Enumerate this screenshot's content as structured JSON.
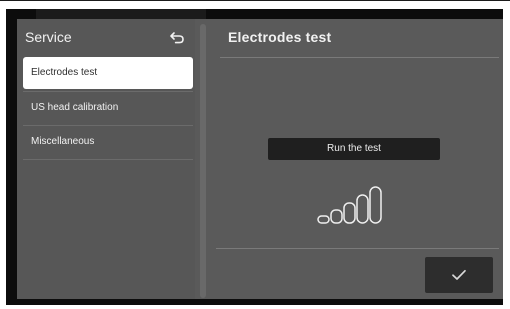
{
  "sidebar": {
    "title": "Service",
    "items": [
      {
        "label": "Electrodes test",
        "active": true
      },
      {
        "label": "US head calibration",
        "active": false
      },
      {
        "label": "Miscellaneous",
        "active": false
      }
    ],
    "back_icon": "back-arrow-icon"
  },
  "content": {
    "title": "Electrodes test",
    "run_button_label": "Run the test",
    "signal_icon": "signal-bars-icon",
    "confirm_icon": "check-icon"
  },
  "colors": {
    "panel_bg": "#5a5a5a",
    "screen_bg": "#0c0c0c",
    "active_item_bg": "#ffffff",
    "button_bg": "#1f1f1f",
    "text_light": "#f2f2f2"
  }
}
